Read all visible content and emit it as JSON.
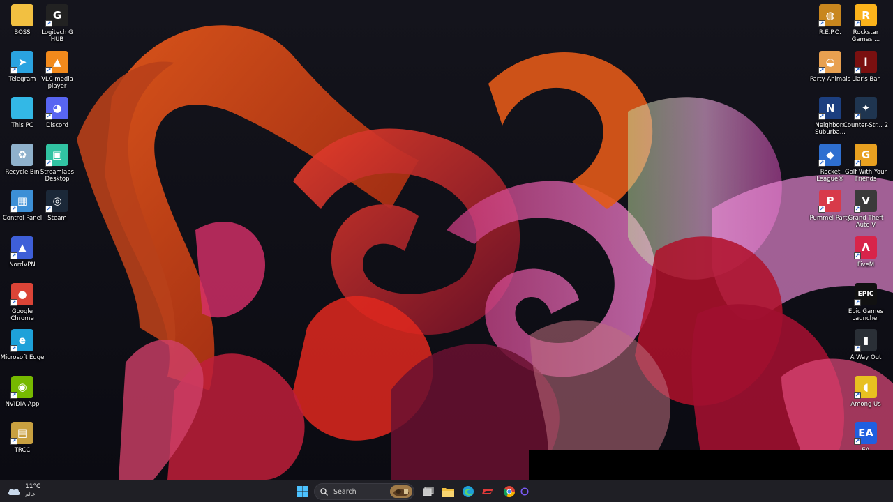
{
  "desktop": {
    "left_col1": [
      {
        "label": "BOSS",
        "icon": "folder-icon",
        "color": "#f2c041"
      },
      {
        "label": "Telegram",
        "icon": "telegram-icon",
        "color": "#2aa3e0"
      },
      {
        "label": "This PC",
        "icon": "monitor-icon",
        "color": "#33b8e6"
      },
      {
        "label": "Recycle Bin",
        "icon": "recycle-bin-icon",
        "color": "#8fb1cc"
      },
      {
        "label": "Control Panel",
        "icon": "control-panel-icon",
        "color": "#3c8fd6"
      },
      {
        "label": "NordVPN",
        "icon": "nordvpn-icon",
        "color": "#3e5fd8"
      },
      {
        "label": "Google Chrome",
        "icon": "chrome-icon",
        "color": "#db4437"
      },
      {
        "label": "Microsoft Edge",
        "icon": "edge-icon",
        "color": "#1ea1d9"
      },
      {
        "label": "NVIDIA App",
        "icon": "nvidia-icon",
        "color": "#76b900"
      },
      {
        "label": "TRCC",
        "icon": "trcc-icon",
        "color": "#c8a040"
      }
    ],
    "left_col2": [
      {
        "label": "Logitech G HUB",
        "icon": "logitech-g-icon",
        "color": "#222222"
      },
      {
        "label": "VLC media player",
        "icon": "vlc-icon",
        "color": "#f28a1c"
      },
      {
        "label": "Discord",
        "icon": "discord-icon",
        "color": "#5865f2"
      },
      {
        "label": "Streamlabs Desktop",
        "icon": "streamlabs-icon",
        "color": "#31c3a2"
      },
      {
        "label": "Steam",
        "icon": "steam-icon",
        "color": "#1b2838"
      }
    ],
    "right_col1": [
      {
        "label": "R.E.P.O.",
        "icon": "repo-game-icon",
        "color": "#c8861e"
      },
      {
        "label": "Party Animals",
        "icon": "party-animals-icon",
        "color": "#e8a050"
      },
      {
        "label": "Neighbors Suburba...",
        "icon": "neighbors-icon",
        "color": "#1c3f80"
      },
      {
        "label": "Rocket League®",
        "icon": "rocket-league-icon",
        "color": "#2e6fd0"
      },
      {
        "label": "Pummel Party",
        "icon": "pummel-party-icon",
        "color": "#d83a4a"
      }
    ],
    "right_col2": [
      {
        "label": "Rockstar Games ...",
        "icon": "rockstar-icon",
        "color": "#fcb31b"
      },
      {
        "label": "Liar's Bar",
        "icon": "liars-bar-icon",
        "color": "#7a1010"
      },
      {
        "label": "Counter-Str... 2",
        "icon": "counter-strike-icon",
        "color": "#1f3550"
      },
      {
        "label": "Golf With Your Friends",
        "icon": "golf-icon",
        "color": "#e8a020"
      },
      {
        "label": "Grand Theft Auto V",
        "icon": "gta-icon",
        "color": "#3a3a3a"
      },
      {
        "label": "FiveM",
        "icon": "fivem-icon",
        "color": "#d8244a"
      },
      {
        "label": "Epic Games Launcher",
        "icon": "epic-games-icon",
        "color": "#111111"
      },
      {
        "label": "A Way Out",
        "icon": "a-way-out-icon",
        "color": "#2a2f36"
      },
      {
        "label": "Among Us",
        "icon": "among-us-icon",
        "color": "#e8c020"
      },
      {
        "label": "EA",
        "icon": "ea-icon",
        "color": "#1f5fe0"
      }
    ]
  },
  "icon_glyphs": {
    "BOSS": "",
    "Telegram": "➤",
    "This PC": "",
    "Recycle Bin": "♻",
    "Control Panel": "▦",
    "NordVPN": "▲",
    "Google Chrome": "●",
    "Microsoft Edge": "e",
    "NVIDIA App": "◉",
    "TRCC": "▤",
    "Logitech G HUB": "G",
    "VLC media player": "▲",
    "Discord": "◕",
    "Streamlabs Desktop": "▣",
    "Steam": "◎",
    "R.E.P.O.": "◍",
    "Party Animals": "◒",
    "Neighbors Suburba...": "N",
    "Rocket League®": "◆",
    "Pummel Party": "P",
    "Rockstar Games ...": "R",
    "Liar's Bar": "l",
    "Counter-Str... 2": "✦",
    "Golf With Your Friends": "G",
    "Grand Theft Auto V": "V",
    "FiveM": "Λ",
    "Epic Games Launcher": "EPIC",
    "A Way Out": "▮",
    "Among Us": "◖",
    "EA": "EA"
  },
  "taskbar": {
    "weather": {
      "temp": "11°C",
      "condition": "غائم",
      "icon": "cloud-icon"
    },
    "search": {
      "placeholder": "Search",
      "icon": "search-icon"
    },
    "pinned": [
      {
        "name": "start-button",
        "icon": "windows-logo-icon",
        "color": "#4cc2ff"
      },
      {
        "name": "task-view-button",
        "icon": "task-view-icon",
        "color": "#e0e0e0"
      },
      {
        "name": "file-explorer-button",
        "icon": "folder-icon",
        "color": "#f2c041"
      },
      {
        "name": "edge-button",
        "icon": "edge-icon",
        "color": "#1ea1d9"
      },
      {
        "name": "app-red-button",
        "icon": "red-app-icon",
        "color": "#e03a3a"
      },
      {
        "name": "chrome-button",
        "icon": "chrome-icon",
        "color": "#db4437"
      },
      {
        "name": "app-purple-button",
        "icon": "purple-app-icon",
        "color": "#7a5af5"
      }
    ]
  }
}
